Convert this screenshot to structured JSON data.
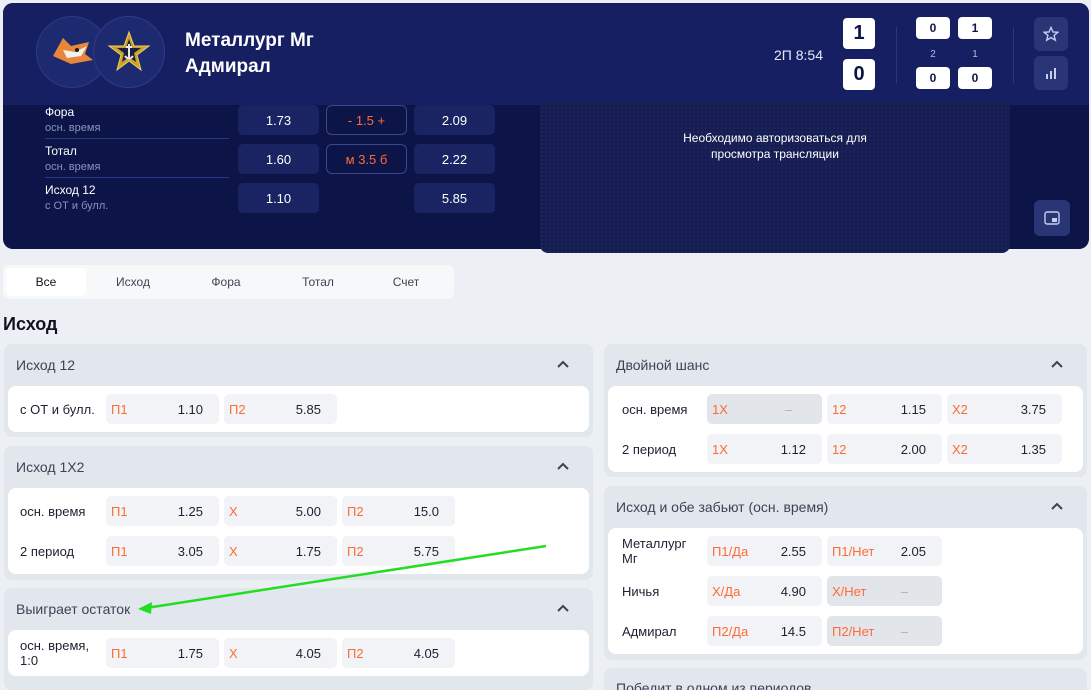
{
  "header": {
    "team1": "Металлург Мг",
    "team2": "Адмирал",
    "period_time": "2П 8:54",
    "score1": "1",
    "score2": "0",
    "periods": {
      "p1_home": "0",
      "p1_away": "0",
      "p2_home": "1",
      "p2_away": "0",
      "p1_label": "2",
      "p2_label": "1"
    },
    "markets": [
      {
        "name": "Фора",
        "sub": "осн. время",
        "odd1": "1.73",
        "line": "- 1.5 +",
        "odd2": "2.09"
      },
      {
        "name": "Тотал",
        "sub": "осн. время",
        "odd1": "1.60",
        "line": "м 3.5 б",
        "odd2": "2.22"
      },
      {
        "name": "Исход 12",
        "sub": "с ОТ и булл.",
        "odd1": "1.10",
        "line": "",
        "odd2": "5.85"
      }
    ],
    "stream_message": "Необходимо авторизоваться для просмотра трансляции"
  },
  "tabs": [
    "Все",
    "Исход",
    "Фора",
    "Тотал",
    "Счет"
  ],
  "section_title": "Исход",
  "cards_left": [
    {
      "title": "Исход 12",
      "rows": [
        {
          "label": "с ОТ и булл.",
          "odds": [
            {
              "l": "П1",
              "v": "1.10"
            },
            {
              "l": "П2",
              "v": "5.85"
            }
          ]
        }
      ]
    },
    {
      "title": "Исход 1Х2",
      "rows": [
        {
          "label": "осн. время",
          "odds": [
            {
              "l": "П1",
              "v": "1.25"
            },
            {
              "l": "Х",
              "v": "5.00"
            },
            {
              "l": "П2",
              "v": "15.0"
            }
          ]
        },
        {
          "label": "2 период",
          "odds": [
            {
              "l": "П1",
              "v": "3.05"
            },
            {
              "l": "Х",
              "v": "1.75"
            },
            {
              "l": "П2",
              "v": "5.75"
            }
          ]
        }
      ]
    },
    {
      "title": "Выиграет остаток",
      "rows": [
        {
          "label": "осн. время, 1:0",
          "odds": [
            {
              "l": "П1",
              "v": "1.75"
            },
            {
              "l": "Х",
              "v": "4.05"
            },
            {
              "l": "П2",
              "v": "4.05"
            }
          ]
        }
      ]
    }
  ],
  "cards_right": [
    {
      "title": "Двойной шанс",
      "rows": [
        {
          "label": "осн. время",
          "odds": [
            {
              "l": "1Х",
              "v": "–"
            },
            {
              "l": "12",
              "v": "1.15"
            },
            {
              "l": "Х2",
              "v": "3.75"
            }
          ]
        },
        {
          "label": "2 период",
          "odds": [
            {
              "l": "1Х",
              "v": "1.12"
            },
            {
              "l": "12",
              "v": "2.00"
            },
            {
              "l": "Х2",
              "v": "1.35"
            }
          ]
        }
      ]
    },
    {
      "title": "Исход и обе забьют (осн. время)",
      "rows": [
        {
          "label": "Металлург Мг",
          "odds": [
            {
              "l": "П1/Да",
              "v": "2.55"
            },
            {
              "l": "П1/Нет",
              "v": "2.05"
            }
          ]
        },
        {
          "label": "Ничья",
          "odds": [
            {
              "l": "Х/Да",
              "v": "4.90"
            },
            {
              "l": "Х/Нет",
              "v": "–"
            }
          ]
        },
        {
          "label": "Адмирал",
          "odds": [
            {
              "l": "П2/Да",
              "v": "14.5"
            },
            {
              "l": "П2/Нет",
              "v": "–"
            }
          ]
        }
      ]
    },
    {
      "title": "Победит в одном из периодов"
    }
  ],
  "colors": {
    "accent": "#ff6b35",
    "header_bg": "#0d1548",
    "annotation_arrow": "#22dd22"
  },
  "icons": {
    "star": "star-icon",
    "stats": "bar-chart-icon",
    "pip": "picture-in-picture-icon",
    "collapse": "chevron-up-icon"
  }
}
